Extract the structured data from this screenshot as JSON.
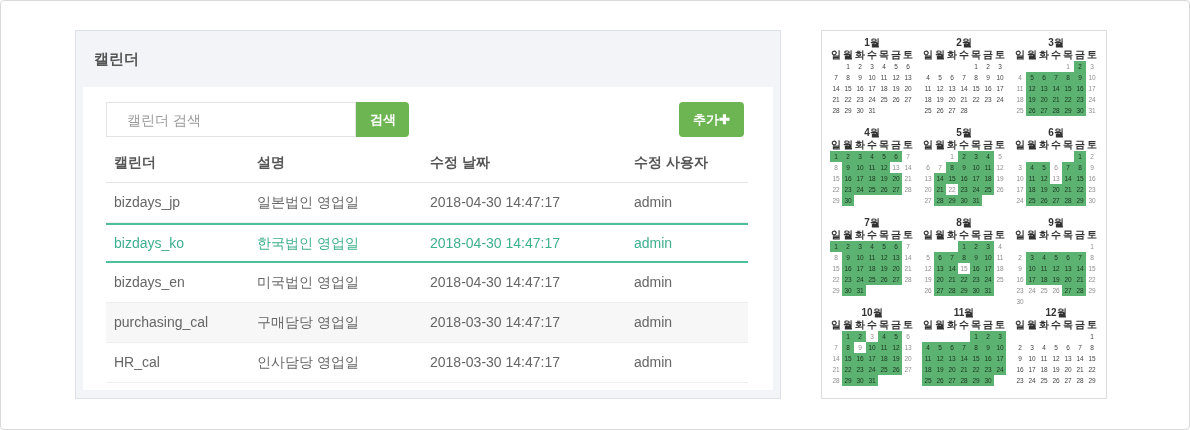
{
  "panel": {
    "title": "캘린더",
    "search": {
      "placeholder": "캘린더 검색",
      "button": "검색"
    },
    "add_button": {
      "label": "추가",
      "icon": "✚"
    },
    "table": {
      "columns": [
        "캘린더",
        "설명",
        "수정 날짜",
        "수정 사용자"
      ],
      "rows": [
        {
          "cells": [
            "bizdays_jp",
            "일본법인 영업일",
            "2018-04-30 14:47:17",
            "admin"
          ],
          "selected": false
        },
        {
          "cells": [
            "bizdays_ko",
            "한국법인 영업일",
            "2018-04-30 14:47:17",
            "admin"
          ],
          "selected": true
        },
        {
          "cells": [
            "bizdays_en",
            "미국법인 영업일",
            "2018-04-30 14:47:17",
            "admin"
          ],
          "selected": false
        },
        {
          "cells": [
            "purchasing_cal",
            "구매담당 영업일",
            "2018-03-30 14:47:17",
            "admin"
          ],
          "selected": false
        },
        {
          "cells": [
            "HR_cal",
            "인사담당 영업일",
            "2018-03-30 14:47:17",
            "admin"
          ],
          "selected": false
        }
      ]
    }
  },
  "calendar": {
    "months": [
      {
        "title": "1월",
        "kind": "plain",
        "weekdays": [
          "일",
          "월",
          "화",
          "수",
          "목",
          "금",
          "토"
        ],
        "weeks": [
          [
            {
              "d": "1"
            },
            {
              "d": "2"
            },
            {
              "d": "3"
            },
            {
              "d": "4"
            },
            {
              "d": "5"
            },
            {
              "d": "6"
            }
          ],
          [
            {
              "d": "7"
            },
            {
              "d": "8"
            },
            {
              "d": "9"
            },
            {
              "d": "10"
            },
            {
              "d": "11"
            },
            {
              "d": "12"
            },
            {
              "d": "13"
            }
          ],
          [
            {
              "d": "14"
            },
            {
              "d": "15"
            },
            {
              "d": "16"
            },
            {
              "d": "17"
            },
            {
              "d": "18"
            },
            {
              "d": "19"
            },
            {
              "d": "20"
            }
          ],
          [
            {
              "d": "21"
            },
            {
              "d": "22"
            },
            {
              "d": "23"
            },
            {
              "d": "24"
            },
            {
              "d": "25"
            },
            {
              "d": "26"
            },
            {
              "d": "27"
            }
          ],
          [
            {
              "d": "28"
            },
            {
              "d": "29"
            },
            {
              "d": "30"
            },
            {
              "d": "31"
            }
          ]
        ]
      },
      {
        "title": "2월",
        "kind": "plain",
        "weekdays": [
          "일",
          "월",
          "화",
          "수",
          "목",
          "금",
          "토"
        ],
        "weeks": [
          [
            {
              "d": "1"
            },
            {
              "d": "2"
            },
            {
              "d": "3"
            }
          ],
          [
            {
              "d": "4"
            },
            {
              "d": "5"
            },
            {
              "d": "6"
            },
            {
              "d": "7"
            },
            {
              "d": "8"
            },
            {
              "d": "9"
            },
            {
              "d": "10"
            }
          ],
          [
            {
              "d": "11"
            },
            {
              "d": "12"
            },
            {
              "d": "13"
            },
            {
              "d": "14"
            },
            {
              "d": "15"
            },
            {
              "d": "16"
            },
            {
              "d": "17"
            }
          ],
          [
            {
              "d": "18"
            },
            {
              "d": "19"
            },
            {
              "d": "20"
            },
            {
              "d": "21"
            },
            {
              "d": "22"
            },
            {
              "d": "23"
            },
            {
              "d": "24"
            }
          ],
          [
            {
              "d": "25"
            },
            {
              "d": "26"
            },
            {
              "d": "27"
            },
            {
              "d": "28"
            }
          ]
        ]
      },
      {
        "title": "3월",
        "kind": "marked",
        "weekdays": [
          "일",
          "월",
          "화",
          "수",
          "목",
          "금",
          "토"
        ],
        "weeks": [
          [
            {
              "d": "1",
              "workday": false
            },
            {
              "d": "2",
              "workday": true
            },
            {
              "d": "3",
              "workday": false
            }
          ],
          [
            {
              "d": "4",
              "workday": false
            },
            {
              "d": "5",
              "workday": true
            },
            {
              "d": "6",
              "workday": true
            },
            {
              "d": "7",
              "workday": true
            },
            {
              "d": "8",
              "workday": true
            },
            {
              "d": "9",
              "workday": true
            },
            {
              "d": "10",
              "workday": false
            }
          ],
          [
            {
              "d": "11",
              "workday": false
            },
            {
              "d": "12",
              "workday": true
            },
            {
              "d": "13",
              "workday": true
            },
            {
              "d": "14",
              "workday": true
            },
            {
              "d": "15",
              "workday": true
            },
            {
              "d": "16",
              "workday": true
            },
            {
              "d": "17",
              "workday": false
            }
          ],
          [
            {
              "d": "18",
              "workday": false
            },
            {
              "d": "19",
              "workday": true
            },
            {
              "d": "20",
              "workday": true
            },
            {
              "d": "21",
              "workday": true
            },
            {
              "d": "22",
              "workday": true
            },
            {
              "d": "23",
              "workday": true
            },
            {
              "d": "24",
              "workday": false
            }
          ],
          [
            {
              "d": "25",
              "workday": false
            },
            {
              "d": "26",
              "workday": true
            },
            {
              "d": "27",
              "workday": true
            },
            {
              "d": "28",
              "workday": true
            },
            {
              "d": "29",
              "workday": true
            },
            {
              "d": "30",
              "workday": true
            },
            {
              "d": "31",
              "workday": false
            }
          ]
        ]
      },
      {
        "title": "4월",
        "kind": "marked",
        "weekdays": [
          "일",
          "월",
          "화",
          "수",
          "목",
          "금",
          "토"
        ],
        "weeks": [
          [
            {
              "d": "1",
              "workday": true
            },
            {
              "d": "2",
              "workday": true
            },
            {
              "d": "3",
              "workday": true
            },
            {
              "d": "4",
              "workday": true
            },
            {
              "d": "5",
              "workday": true
            },
            {
              "d": "6",
              "workday": true
            },
            {
              "d": "7",
              "workday": false
            }
          ],
          [
            {
              "d": "8",
              "workday": false
            },
            {
              "d": "9",
              "workday": true
            },
            {
              "d": "10",
              "workday": true
            },
            {
              "d": "11",
              "workday": true
            },
            {
              "d": "12",
              "workday": true
            },
            {
              "d": "13",
              "workday": false
            },
            {
              "d": "14",
              "workday": false
            }
          ],
          [
            {
              "d": "15",
              "workday": false
            },
            {
              "d": "16",
              "workday": true
            },
            {
              "d": "17",
              "workday": true
            },
            {
              "d": "18",
              "workday": true
            },
            {
              "d": "19",
              "workday": true
            },
            {
              "d": "20",
              "workday": true
            },
            {
              "d": "21",
              "workday": false
            }
          ],
          [
            {
              "d": "22",
              "workday": false
            },
            {
              "d": "23",
              "workday": true
            },
            {
              "d": "24",
              "workday": true
            },
            {
              "d": "25",
              "workday": true
            },
            {
              "d": "26",
              "workday": true
            },
            {
              "d": "27",
              "workday": true
            },
            {
              "d": "28",
              "workday": false
            }
          ],
          [
            {
              "d": "29",
              "workday": false
            },
            {
              "d": "30",
              "workday": true
            }
          ]
        ]
      },
      {
        "title": "5월",
        "kind": "marked",
        "weekdays": [
          "일",
          "월",
          "화",
          "수",
          "목",
          "금",
          "토"
        ],
        "weeks": [
          [
            {
              "d": "1",
              "workday": false
            },
            {
              "d": "2",
              "workday": true
            },
            {
              "d": "3",
              "workday": true
            },
            {
              "d": "4",
              "workday": true
            },
            {
              "d": "5",
              "workday": false
            }
          ],
          [
            {
              "d": "6",
              "workday": false
            },
            {
              "d": "7",
              "workday": false
            },
            {
              "d": "8",
              "workday": true
            },
            {
              "d": "9",
              "workday": true
            },
            {
              "d": "10",
              "workday": true
            },
            {
              "d": "11",
              "workday": true
            },
            {
              "d": "12",
              "workday": false
            }
          ],
          [
            {
              "d": "13",
              "workday": false
            },
            {
              "d": "14",
              "workday": true
            },
            {
              "d": "15",
              "workday": true
            },
            {
              "d": "16",
              "workday": true
            },
            {
              "d": "17",
              "workday": true
            },
            {
              "d": "18",
              "workday": true
            },
            {
              "d": "19",
              "workday": false
            }
          ],
          [
            {
              "d": "20",
              "workday": false
            },
            {
              "d": "21",
              "workday": true
            },
            {
              "d": "22",
              "workday": false
            },
            {
              "d": "23",
              "workday": true
            },
            {
              "d": "24",
              "workday": true
            },
            {
              "d": "25",
              "workday": true
            },
            {
              "d": "26",
              "workday": false
            }
          ],
          [
            {
              "d": "27",
              "workday": false
            },
            {
              "d": "28",
              "workday": true
            },
            {
              "d": "29",
              "workday": true
            },
            {
              "d": "30",
              "workday": true
            },
            {
              "d": "31",
              "workday": true
            }
          ]
        ]
      },
      {
        "title": "6월",
        "kind": "marked",
        "weekdays": [
          "일",
          "월",
          "화",
          "수",
          "목",
          "금",
          "토"
        ],
        "weeks": [
          [
            {
              "d": "1",
              "workday": true
            },
            {
              "d": "2",
              "workday": false
            }
          ],
          [
            {
              "d": "3",
              "workday": false
            },
            {
              "d": "4",
              "workday": true
            },
            {
              "d": "5",
              "workday": true
            },
            {
              "d": "6",
              "workday": false
            },
            {
              "d": "7",
              "workday": true
            },
            {
              "d": "8",
              "workday": true
            },
            {
              "d": "9",
              "workday": false
            }
          ],
          [
            {
              "d": "10",
              "workday": false
            },
            {
              "d": "11",
              "workday": true
            },
            {
              "d": "12",
              "workday": true
            },
            {
              "d": "13",
              "workday": false
            },
            {
              "d": "14",
              "workday": true
            },
            {
              "d": "15",
              "workday": true
            },
            {
              "d": "16",
              "workday": false
            }
          ],
          [
            {
              "d": "17",
              "workday": false
            },
            {
              "d": "18",
              "workday": true
            },
            {
              "d": "19",
              "workday": true
            },
            {
              "d": "20",
              "workday": true
            },
            {
              "d": "21",
              "workday": true
            },
            {
              "d": "22",
              "workday": true
            },
            {
              "d": "23",
              "workday": false
            }
          ],
          [
            {
              "d": "24",
              "workday": false
            },
            {
              "d": "25",
              "workday": true
            },
            {
              "d": "26",
              "workday": true
            },
            {
              "d": "27",
              "workday": true
            },
            {
              "d": "28",
              "workday": true
            },
            {
              "d": "29",
              "workday": true
            },
            {
              "d": "30",
              "workday": false
            }
          ]
        ]
      },
      {
        "title": "7월",
        "kind": "marked",
        "weekdays": [
          "일",
          "월",
          "화",
          "수",
          "목",
          "금",
          "토"
        ],
        "weeks": [
          [
            {
              "d": "1",
              "workday": true
            },
            {
              "d": "2",
              "workday": true
            },
            {
              "d": "3",
              "workday": true
            },
            {
              "d": "4",
              "workday": true
            },
            {
              "d": "5",
              "workday": true
            },
            {
              "d": "6",
              "workday": true
            },
            {
              "d": "7",
              "workday": false
            }
          ],
          [
            {
              "d": "8",
              "workday": false
            },
            {
              "d": "9",
              "workday": true
            },
            {
              "d": "10",
              "workday": true
            },
            {
              "d": "11",
              "workday": true
            },
            {
              "d": "12",
              "workday": true
            },
            {
              "d": "13",
              "workday": true
            },
            {
              "d": "14",
              "workday": false
            }
          ],
          [
            {
              "d": "15",
              "workday": false
            },
            {
              "d": "16",
              "workday": true
            },
            {
              "d": "17",
              "workday": true
            },
            {
              "d": "18",
              "workday": true
            },
            {
              "d": "19",
              "workday": true
            },
            {
              "d": "20",
              "workday": true
            },
            {
              "d": "21",
              "workday": false
            }
          ],
          [
            {
              "d": "22",
              "workday": false
            },
            {
              "d": "23",
              "workday": true
            },
            {
              "d": "24",
              "workday": true
            },
            {
              "d": "25",
              "workday": true
            },
            {
              "d": "26",
              "workday": true
            },
            {
              "d": "27",
              "workday": true
            },
            {
              "d": "28",
              "workday": false
            }
          ],
          [
            {
              "d": "29",
              "workday": false
            },
            {
              "d": "30",
              "workday": true
            },
            {
              "d": "31",
              "workday": true
            }
          ]
        ]
      },
      {
        "title": "8월",
        "kind": "marked",
        "weekdays": [
          "일",
          "월",
          "화",
          "수",
          "목",
          "금",
          "토"
        ],
        "weeks": [
          [
            {
              "d": "1",
              "workday": true
            },
            {
              "d": "2",
              "workday": true
            },
            {
              "d": "3",
              "workday": true
            },
            {
              "d": "4",
              "workday": false
            }
          ],
          [
            {
              "d": "5",
              "workday": false
            },
            {
              "d": "6",
              "workday": true
            },
            {
              "d": "7",
              "workday": true
            },
            {
              "d": "8",
              "workday": true
            },
            {
              "d": "9",
              "workday": true
            },
            {
              "d": "10",
              "workday": true
            },
            {
              "d": "11",
              "workday": false
            }
          ],
          [
            {
              "d": "12",
              "workday": false
            },
            {
              "d": "13",
              "workday": true
            },
            {
              "d": "14",
              "workday": true
            },
            {
              "d": "15",
              "workday": false
            },
            {
              "d": "16",
              "workday": true
            },
            {
              "d": "17",
              "workday": true
            },
            {
              "d": "18",
              "workday": false
            }
          ],
          [
            {
              "d": "19",
              "workday": false
            },
            {
              "d": "20",
              "workday": true
            },
            {
              "d": "21",
              "workday": true
            },
            {
              "d": "22",
              "workday": true
            },
            {
              "d": "23",
              "workday": true
            },
            {
              "d": "24",
              "workday": true
            },
            {
              "d": "25",
              "workday": false
            }
          ],
          [
            {
              "d": "26",
              "workday": false
            },
            {
              "d": "27",
              "workday": true
            },
            {
              "d": "28",
              "workday": true
            },
            {
              "d": "29",
              "workday": true
            },
            {
              "d": "30",
              "workday": true
            },
            {
              "d": "31",
              "workday": true
            }
          ]
        ]
      },
      {
        "title": "9월",
        "kind": "marked",
        "weekdays": [
          "일",
          "월",
          "화",
          "수",
          "목",
          "금",
          "토"
        ],
        "weeks": [
          [
            {
              "d": "1",
              "workday": false
            }
          ],
          [
            {
              "d": "2",
              "workday": false
            },
            {
              "d": "3",
              "workday": true
            },
            {
              "d": "4",
              "workday": true
            },
            {
              "d": "5",
              "workday": true
            },
            {
              "d": "6",
              "workday": true
            },
            {
              "d": "7",
              "workday": true
            },
            {
              "d": "8",
              "workday": false
            }
          ],
          [
            {
              "d": "9",
              "workday": false
            },
            {
              "d": "10",
              "workday": true
            },
            {
              "d": "11",
              "workday": true
            },
            {
              "d": "12",
              "workday": true
            },
            {
              "d": "13",
              "workday": true
            },
            {
              "d": "14",
              "workday": true
            },
            {
              "d": "15",
              "workday": false
            }
          ],
          [
            {
              "d": "16",
              "workday": false
            },
            {
              "d": "17",
              "workday": true
            },
            {
              "d": "18",
              "workday": true
            },
            {
              "d": "19",
              "workday": true
            },
            {
              "d": "20",
              "workday": true
            },
            {
              "d": "21",
              "workday": true
            },
            {
              "d": "22",
              "workday": false
            }
          ],
          [
            {
              "d": "23",
              "workday": false
            },
            {
              "d": "24",
              "workday": false
            },
            {
              "d": "25",
              "workday": false
            },
            {
              "d": "26",
              "workday": false
            },
            {
              "d": "27",
              "workday": true
            },
            {
              "d": "28",
              "workday": true
            },
            {
              "d": "29",
              "workday": false
            }
          ],
          [
            {
              "d": "30",
              "workday": false
            }
          ]
        ]
      },
      {
        "title": "10월",
        "kind": "marked",
        "weekdays": [
          "일",
          "월",
          "화",
          "수",
          "목",
          "금",
          "토"
        ],
        "weeks": [
          [
            {
              "d": "1",
              "workday": true
            },
            {
              "d": "2",
              "workday": true
            },
            {
              "d": "3",
              "workday": false
            },
            {
              "d": "4",
              "workday": true
            },
            {
              "d": "5",
              "workday": true
            },
            {
              "d": "6",
              "workday": false
            }
          ],
          [
            {
              "d": "7",
              "workday": false
            },
            {
              "d": "8",
              "workday": true
            },
            {
              "d": "9",
              "workday": false
            },
            {
              "d": "10",
              "workday": true
            },
            {
              "d": "11",
              "workday": true
            },
            {
              "d": "12",
              "workday": true
            },
            {
              "d": "13",
              "workday": false
            }
          ],
          [
            {
              "d": "14",
              "workday": false
            },
            {
              "d": "15",
              "workday": true
            },
            {
              "d": "16",
              "workday": true
            },
            {
              "d": "17",
              "workday": true
            },
            {
              "d": "18",
              "workday": true
            },
            {
              "d": "19",
              "workday": true
            },
            {
              "d": "20",
              "workday": false
            }
          ],
          [
            {
              "d": "21",
              "workday": false
            },
            {
              "d": "22",
              "workday": true
            },
            {
              "d": "23",
              "workday": true
            },
            {
              "d": "24",
              "workday": true
            },
            {
              "d": "25",
              "workday": true
            },
            {
              "d": "26",
              "workday": true
            },
            {
              "d": "27",
              "workday": false
            }
          ],
          [
            {
              "d": "28",
              "workday": false
            },
            {
              "d": "29",
              "workday": true
            },
            {
              "d": "30",
              "workday": true
            },
            {
              "d": "31",
              "workday": true
            }
          ]
        ]
      },
      {
        "title": "11월",
        "kind": "marked",
        "weekdays": [
          "일",
          "월",
          "화",
          "수",
          "목",
          "금",
          "토"
        ],
        "weeks": [
          [
            {
              "d": "1",
              "workday": true
            },
            {
              "d": "2",
              "workday": true
            },
            {
              "d": "3",
              "workday": true
            }
          ],
          [
            {
              "d": "4",
              "workday": true
            },
            {
              "d": "5",
              "workday": true
            },
            {
              "d": "6",
              "workday": true
            },
            {
              "d": "7",
              "workday": true
            },
            {
              "d": "8",
              "workday": true
            },
            {
              "d": "9",
              "workday": true
            },
            {
              "d": "10",
              "workday": true
            }
          ],
          [
            {
              "d": "11",
              "workday": true
            },
            {
              "d": "12",
              "workday": true
            },
            {
              "d": "13",
              "workday": true
            },
            {
              "d": "14",
              "workday": true
            },
            {
              "d": "15",
              "workday": true
            },
            {
              "d": "16",
              "workday": true
            },
            {
              "d": "17",
              "workday": true
            }
          ],
          [
            {
              "d": "18",
              "workday": true
            },
            {
              "d": "19",
              "workday": true
            },
            {
              "d": "20",
              "workday": true
            },
            {
              "d": "21",
              "workday": true
            },
            {
              "d": "22",
              "workday": true
            },
            {
              "d": "23",
              "workday": true
            },
            {
              "d": "24",
              "workday": true
            }
          ],
          [
            {
              "d": "25",
              "workday": true
            },
            {
              "d": "26",
              "workday": true
            },
            {
              "d": "27",
              "workday": true
            },
            {
              "d": "28",
              "workday": true
            },
            {
              "d": "29",
              "workday": true
            },
            {
              "d": "30",
              "workday": true
            }
          ]
        ]
      },
      {
        "title": "12월",
        "kind": "plain",
        "weekdays": [
          "일",
          "월",
          "화",
          "수",
          "목",
          "금",
          "토"
        ],
        "weeks": [
          [
            {
              "d": "1"
            }
          ],
          [
            {
              "d": "2"
            },
            {
              "d": "3"
            },
            {
              "d": "4"
            },
            {
              "d": "5"
            },
            {
              "d": "6"
            },
            {
              "d": "7"
            },
            {
              "d": "8"
            }
          ],
          [
            {
              "d": "9"
            },
            {
              "d": "10"
            },
            {
              "d": "11"
            },
            {
              "d": "12"
            },
            {
              "d": "13"
            },
            {
              "d": "14"
            },
            {
              "d": "15"
            }
          ],
          [
            {
              "d": "16"
            },
            {
              "d": "17"
            },
            {
              "d": "18"
            },
            {
              "d": "19"
            },
            {
              "d": "20"
            },
            {
              "d": "21"
            },
            {
              "d": "22"
            }
          ],
          [
            {
              "d": "23"
            },
            {
              "d": "24"
            },
            {
              "d": "25"
            },
            {
              "d": "26"
            },
            {
              "d": "27"
            },
            {
              "d": "28"
            },
            {
              "d": "29"
            }
          ]
        ]
      }
    ]
  }
}
